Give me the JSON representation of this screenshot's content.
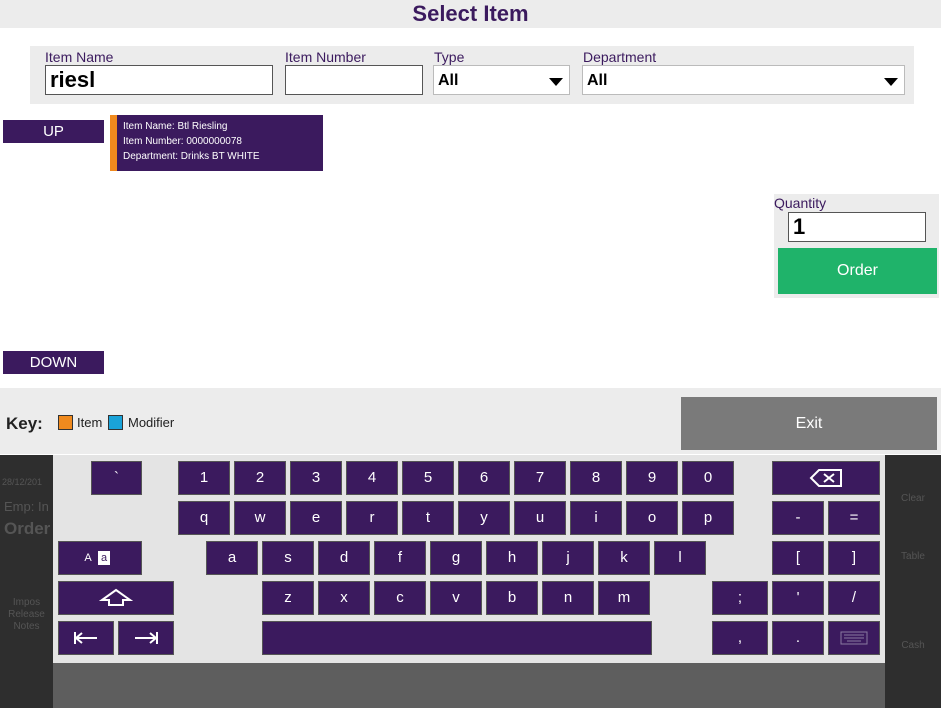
{
  "header": {
    "title": "Select Item"
  },
  "filters": {
    "item_name_label": "Item Name",
    "item_name_value": "riesl",
    "item_number_label": "Item Number",
    "item_number_value": "",
    "type_label": "Type",
    "type_value": "All",
    "department_label": "Department",
    "department_value": "All"
  },
  "nav": {
    "up": "UP",
    "down": "DOWN"
  },
  "item": {
    "name_line": "Item Name: Btl Riesling",
    "number_line": "Item Number: 0000000078",
    "department_line": "Department: Drinks BT WHITE",
    "type_color": "#f08a1e"
  },
  "quantity": {
    "label": "Quantity",
    "value": "1",
    "order_label": "Order"
  },
  "legend": {
    "title": "Key:",
    "item_label": "Item",
    "item_color": "#f08a1e",
    "modifier_label": "Modifier",
    "modifier_color": "#1aa3d9"
  },
  "exit_label": "Exit",
  "background": {
    "date": "28/12/201",
    "emp": "Emp: In",
    "order": "Order",
    "impos_1": "Impos",
    "impos_2": "Release",
    "impos_3": "Notes",
    "clear": "Clear",
    "table": "Table",
    "cash": "Cash"
  },
  "keyboard": {
    "backtick": "`",
    "row1": [
      "1",
      "2",
      "3",
      "4",
      "5",
      "6",
      "7",
      "8",
      "9",
      "0"
    ],
    "row2": [
      "q",
      "w",
      "e",
      "r",
      "t",
      "y",
      "u",
      "i",
      "o",
      "p"
    ],
    "row3": [
      "a",
      "s",
      "d",
      "f",
      "g",
      "h",
      "j",
      "k",
      "l"
    ],
    "row4": [
      "z",
      "x",
      "c",
      "v",
      "b",
      "n",
      "m"
    ],
    "minus": "-",
    "equals": "=",
    "lbracket": "[",
    "rbracket": "]",
    "semicolon": ";",
    "quote": "'",
    "slash": "/",
    "comma": ",",
    "period": ".",
    "case_upper": "A",
    "case_lower": "a"
  },
  "colors": {
    "brand": "#3b1a5e",
    "order_green": "#1fb36a",
    "exit_gray": "#7a7a7a"
  }
}
